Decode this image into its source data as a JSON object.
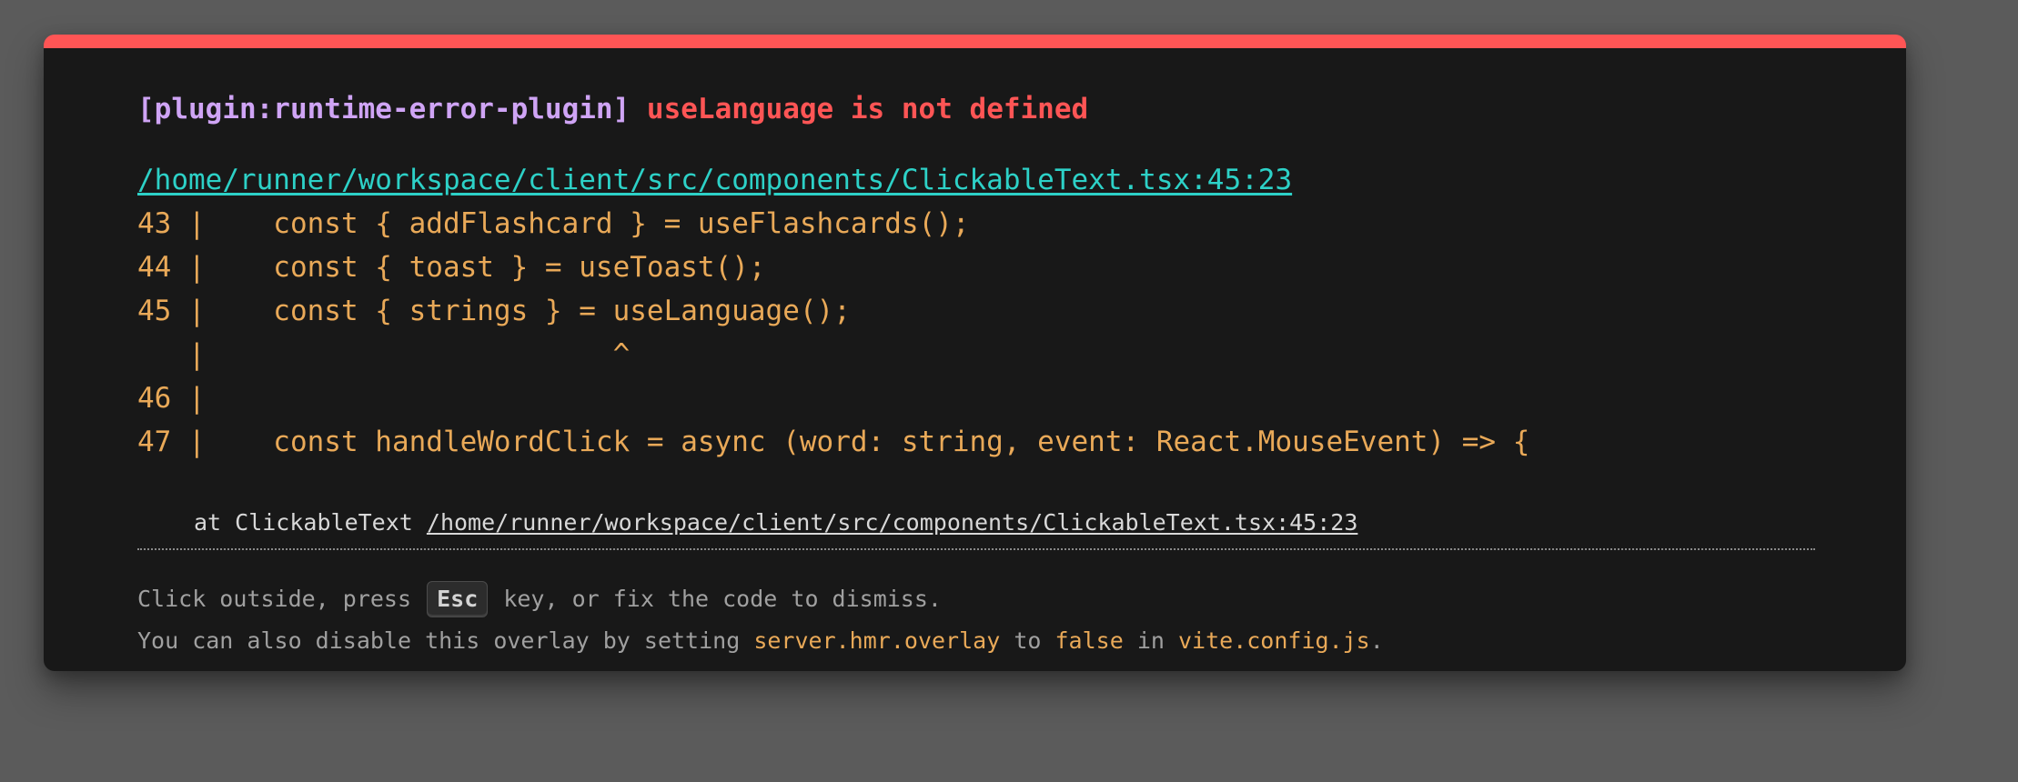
{
  "overlay": {
    "plugin_tag": "[plugin:runtime-error-plugin]",
    "message": "useLanguage is not defined",
    "file_link": "/home/runner/workspace/client/src/components/ClickableText.tsx:45:23",
    "code_frame": [
      "43 |    const { addFlashcard } = useFlashcards();",
      "44 |    const { toast } = useToast();",
      "45 |    const { strings } = useLanguage();",
      "   |                        ^",
      "46 |",
      "47 |    const handleWordClick = async (word: string, event: React.MouseEvent) => {"
    ],
    "stack_prefix": "at ClickableText",
    "stack_link": "/home/runner/workspace/client/src/components/ClickableText.tsx:45:23",
    "tip": {
      "line1_a": "Click outside, press",
      "esc_key": "Esc",
      "line1_b": "key, or fix the code to dismiss.",
      "line2_a": "You can also disable this overlay by setting",
      "config_key": "server.hmr.overlay",
      "line2_b": "to",
      "false_value": "false",
      "line2_c": "in",
      "config_file": "vite.config.js",
      "line2_end": "."
    },
    "colors": {
      "accent_red": "#ff5555",
      "plugin_purple": "#cfa4f5",
      "link_cyan": "#2dd1c7",
      "code_orange": "#e9a958",
      "background": "#181818"
    }
  }
}
